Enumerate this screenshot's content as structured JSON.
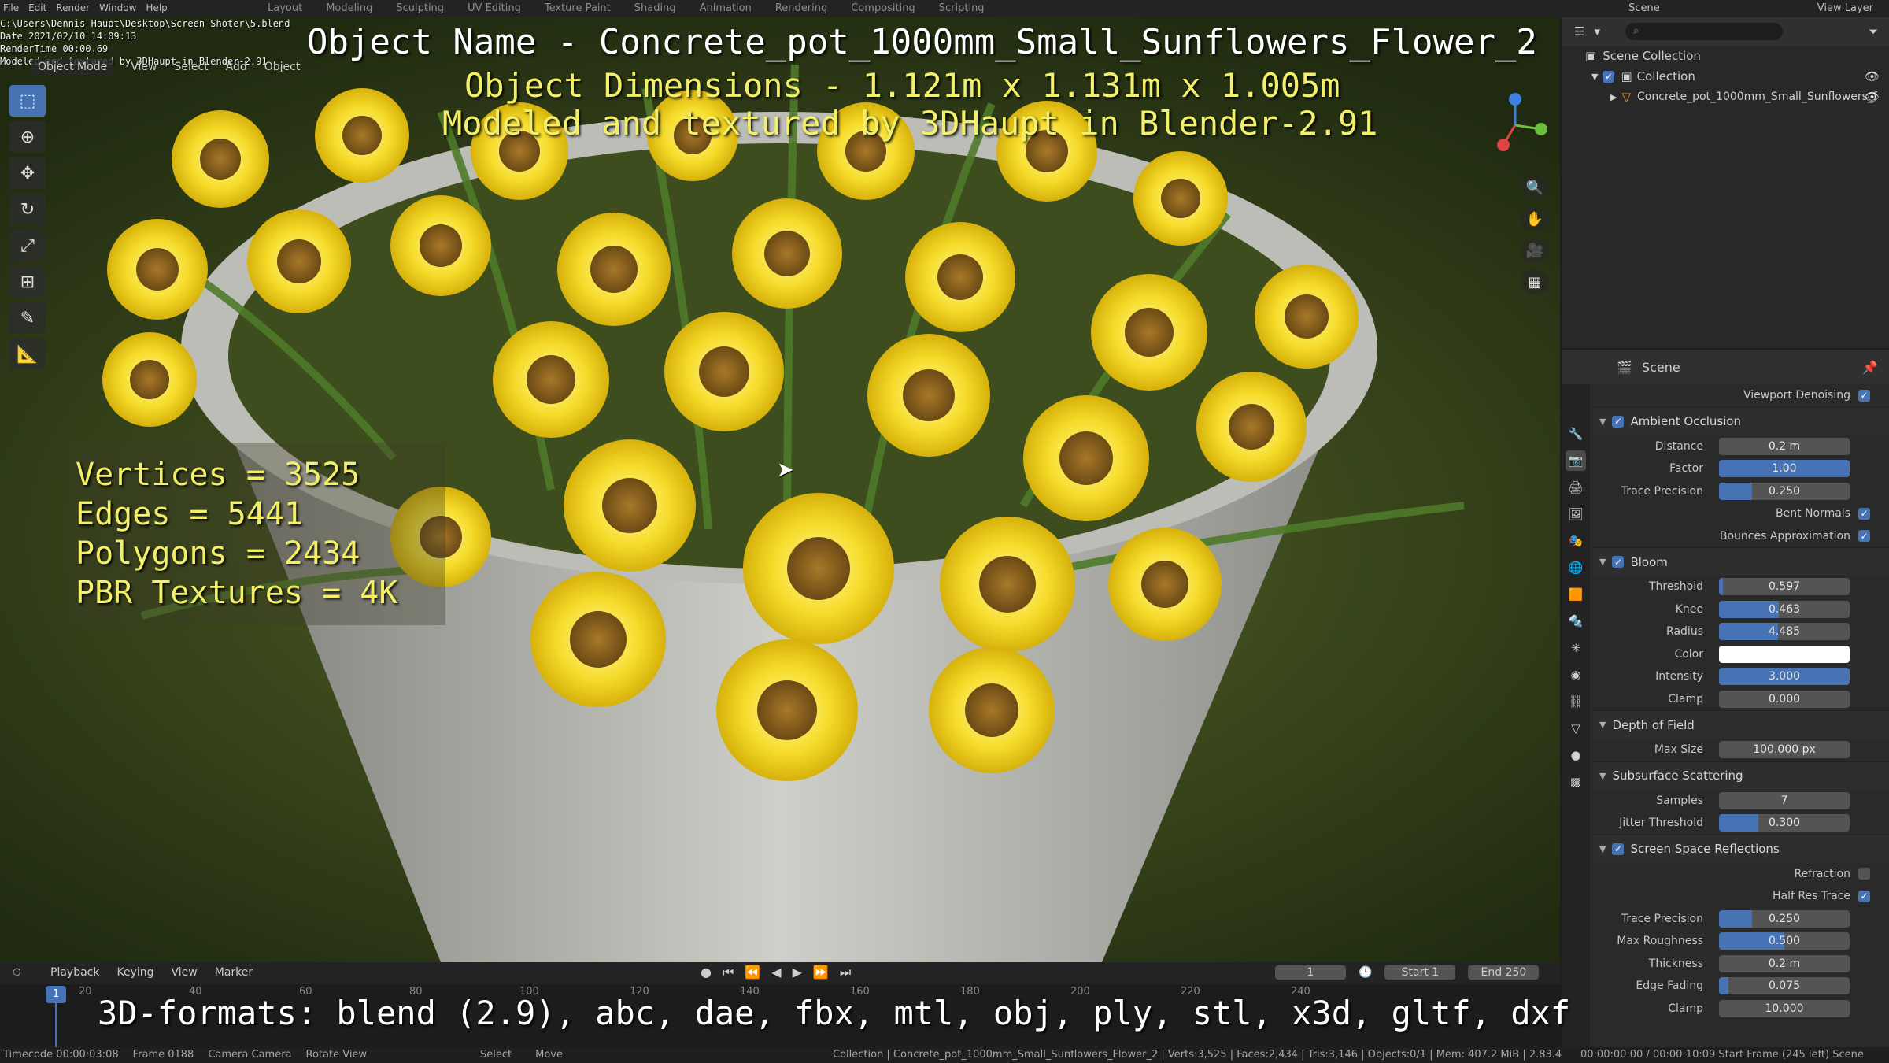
{
  "topbar": {
    "menus": [
      "File",
      "Edit",
      "Render",
      "Window",
      "Help"
    ],
    "workspaces": [
      "Layout",
      "Modeling",
      "Sculpting",
      "UV Editing",
      "Texture Paint",
      "Shading",
      "Animation",
      "Rendering",
      "Compositing",
      "Scripting"
    ],
    "scene_label": "Scene",
    "view_layer_label": "View Layer"
  },
  "viewport": {
    "file_path": "C:\\Users\\Dennis Haupt\\Desktop\\Screen Shoter\\5.blend",
    "date": "Date 2021/02/10 14:09:13",
    "render_time": "RenderTime 00:00.69",
    "credit_small": "Modeled and textured by 3DHaupt in Blender-2.91",
    "mode": "Object Mode",
    "header_menus": [
      "View",
      "Select",
      "Add",
      "Object"
    ],
    "object_name": "Object Name - Concrete_pot_1000mm_Small_Sunflowers_Flower_2",
    "object_dims": "Object Dimensions -  1.121m x 1.131m x 1.005m",
    "credit": "Modeled and textured by 3DHaupt in Blender-2.91",
    "stats": [
      "Vertices = 3525",
      "Edges = 5441",
      "Polygons = 2434",
      "PBR Textures = 4K"
    ],
    "formats": "3D-formats: blend (2.9), abc, dae, fbx, mtl, obj, ply, stl, x3d, gltf, dxf"
  },
  "toolbar_icons": [
    "select-box-icon",
    "cursor-icon",
    "move-icon",
    "rotate-icon",
    "scale-icon",
    "transform-icon",
    "annotate-icon",
    "measure-icon"
  ],
  "outliner": {
    "scene_collection": "Scene Collection",
    "collection": "Collection",
    "object": "Concrete_pot_1000mm_Small_Sunflowers_f"
  },
  "properties": {
    "header": "Scene",
    "viewport_denoising": "Viewport Denoising",
    "ambient_occlusion": {
      "title": "Ambient Occlusion",
      "distance_label": "Distance",
      "distance": "0.2 m",
      "factor_label": "Factor",
      "factor": "1.00",
      "factor_fill": 1.0,
      "trace_precision_label": "Trace Precision",
      "trace_precision": "0.250",
      "trace_precision_fill": 0.25,
      "bent_normals": "Bent Normals",
      "bounces_approx": "Bounces Approximation"
    },
    "bloom": {
      "title": "Bloom",
      "threshold_label": "Threshold",
      "threshold": "0.597",
      "threshold_fill": 0.03,
      "knee_label": "Knee",
      "knee": "0.463",
      "knee_fill": 0.46,
      "radius_label": "Radius",
      "radius": "4.485",
      "radius_fill": 0.45,
      "color_label": "Color",
      "intensity_label": "Intensity",
      "intensity": "3.000",
      "intensity_fill": 1.0,
      "clamp_label": "Clamp",
      "clamp": "0.000"
    },
    "depth_of_field": {
      "title": "Depth of Field",
      "max_size_label": "Max Size",
      "max_size": "100.000 px"
    },
    "subsurface": {
      "title": "Subsurface Scattering",
      "samples_label": "Samples",
      "samples": "7",
      "jitter_label": "Jitter Threshold",
      "jitter": "0.300",
      "jitter_fill": 0.3
    },
    "ssr": {
      "title": "Screen Space Reflections",
      "refraction": "Refraction",
      "half_res": "Half Res Trace",
      "trace_precision_label": "Trace Precision",
      "trace_precision": "0.250",
      "trace_precision_fill": 0.25,
      "max_roughness_label": "Max Roughness",
      "max_roughness": "0.500",
      "max_roughness_fill": 0.5,
      "thickness_label": "Thickness",
      "thickness": "0.2 m",
      "edge_fading_label": "Edge Fading",
      "edge_fading": "0.075",
      "edge_fading_fill": 0.075,
      "clamp_label": "Clamp",
      "clamp": "10.000"
    }
  },
  "timeline": {
    "menus": [
      "Playback",
      "Keying",
      "View",
      "Marker"
    ],
    "current_frame": "1",
    "start_label": "Start",
    "start": "1",
    "end_label": "End",
    "end": "250",
    "ticks": [
      "1",
      "20",
      "40",
      "60",
      "80",
      "100",
      "120",
      "140",
      "160",
      "180",
      "200",
      "220",
      "240"
    ]
  },
  "statusbar": {
    "timecode": "Timecode 00:00:03:08",
    "frame": "Frame 0188",
    "camera": "Camera Camera",
    "rotate": "Rotate View",
    "select": "Select",
    "move": "Move",
    "info": "Collection | Concrete_pot_1000mm_Small_Sunflowers_Flower_2 | Verts:3,525 | Faces:2,434 | Tris:3,146 | Objects:0/1 | Mem: 407.2 MiB | 2.83.4",
    "right_info": "00:00:00:00 / 00:00:10:09   Start Frame (245 left)   Scene"
  }
}
